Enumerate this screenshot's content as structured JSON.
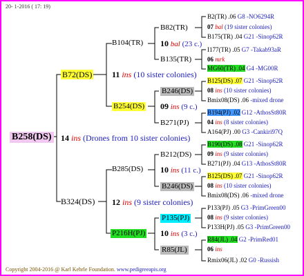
{
  "header": {
    "date": "20-  1-2016 ( 17: 19)"
  },
  "labels": {
    "ins": "ins"
  },
  "root": {
    "name": "B258(DS)",
    "ins_count": "14",
    "note": "(Drones from 10 sister colonies)"
  },
  "gen1": [
    {
      "name": "B72(DS)",
      "ins_count": "11",
      "note": "(10 sister colonies)"
    },
    {
      "name": "B324(DS)",
      "ins_count": "12",
      "note": "(9 sister colonies)"
    }
  ],
  "gen2": [
    {
      "name": "B104(TR)",
      "ins_count": "10",
      "ins_label": "bal",
      "note": "(23 c.)"
    },
    {
      "name": "B254(DS)",
      "ins_count": "09",
      "ins_label": "ins",
      "note": "(9 c.)"
    },
    {
      "name": "B285(DS)",
      "ins_count": "10",
      "ins_label": "ins",
      "note": "(11 c.)"
    },
    {
      "name": "P216H(PJ)",
      "ins_count": "10",
      "ins_label": "ins",
      "note": "(3 c.)"
    }
  ],
  "gen3": [
    {
      "name": "B82(TR)"
    },
    {
      "name": "B135(TR)"
    },
    {
      "name": "B246(DS)"
    },
    {
      "name": "B271(PJ)"
    },
    {
      "name": "B212(DS)"
    },
    {
      "name": "B246(DS)"
    },
    {
      "name": "P135(PJ)"
    },
    {
      "name": "R85(JL)"
    }
  ],
  "gen4": [
    {
      "a": "B2(TR) .06",
      "a2": "G8 -NO6294R",
      "b": "07",
      "b2": "bal",
      "b3": "(19 sister colonies)",
      "c": "B175(TR) .04",
      "c2": "G21 -Sinop62R"
    },
    {
      "a": "I177(TR) .05",
      "a2": "G7 -Takab93aR",
      "b": "06",
      "b2": "mrk",
      "c": "MG60(TR) .04",
      "c2": "G4 -MG00R"
    },
    {
      "a": "B125(DS) .07",
      "a2": "G21 -Sinop62R",
      "b": "08",
      "b2": "ins",
      "b3": "(10 sister colonies)",
      "c": "Bmix08(DS) .06",
      "c2": "-mixed drone"
    },
    {
      "a": "B194(PJ) .02",
      "a2": "G12 -AthosSt80R",
      "b": "04",
      "b2": "ins",
      "b3": "(8 sister colonies)",
      "c": "A164(PJ) .00",
      "c2": "G3 -Cankiri97Q"
    },
    {
      "a": "B190(DS) .08",
      "a2": "G21 -Sinop62R",
      "b": "09",
      "b2": "ins",
      "b3": "(9 sister colonies)",
      "c": "B271(PJ) .04",
      "c2": "G13 -AthosSt80R"
    },
    {
      "a": "B125(DS) .07",
      "a2": "G21 -Sinop62R",
      "b": "08",
      "b2": "ins",
      "b3": "(10 sister colonies)",
      "c": "Bmix08(DS) .06",
      "c2": "-mixed drone"
    },
    {
      "a": "P133(PJ) .05",
      "a2": "G3 -PrimGreen00",
      "b": "08",
      "b2": "ins",
      "b3": "(9 sister colonies)",
      "c": "P133H(PJ) .05",
      "c2": "G3 -PrimGreen00"
    },
    {
      "a": "R84(JL) .04",
      "a2": "G2 -PrimRed01",
      "b": "06",
      "b2": "ins",
      "c": "Rmix06(JL) .02",
      "c2": "G0 -Russish"
    }
  ],
  "footer": {
    "copyright": "Copyright 2004-2016 @ Karl Kehrle Foundation.",
    "site": "www.pedigreeapis.org"
  }
}
